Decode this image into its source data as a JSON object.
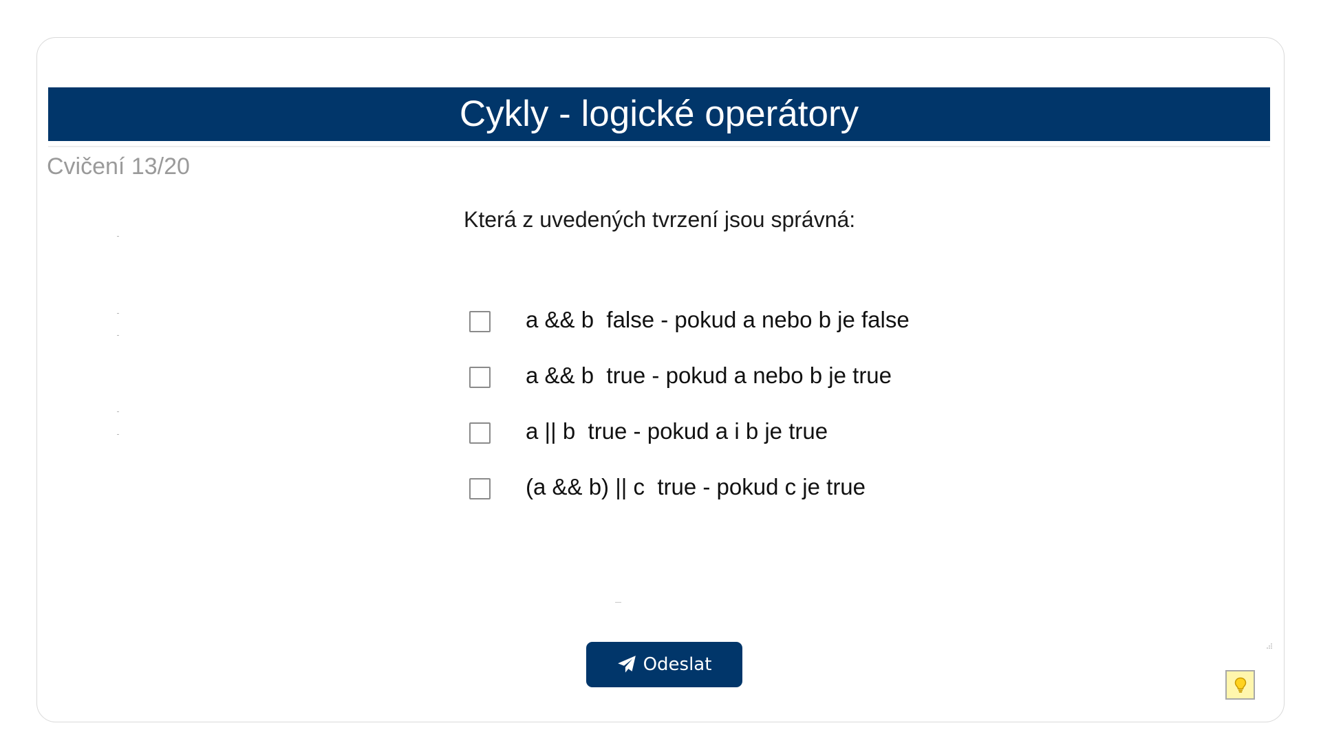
{
  "header": {
    "title": "Cykly - logické operátory"
  },
  "exercise": {
    "counter": "Cvičení 13/20",
    "question": "Která z uvedených tvrzení jsou správná:"
  },
  "options": [
    {
      "label": "a && b  false - pokud a nebo b je false",
      "checked": false
    },
    {
      "label": "a && b  true - pokud a nebo b je true",
      "checked": false
    },
    {
      "label": "a || b  true - pokud a i b je true",
      "checked": false
    },
    {
      "label": "(a && b) || c  true - pokud c je true",
      "checked": false
    }
  ],
  "actions": {
    "submit_label": "Odeslat",
    "submit_icon": "paper-plane-icon",
    "hint_icon": "lightbulb-icon"
  },
  "colors": {
    "primary": "#01366a",
    "hint_background": "#fff6ad"
  }
}
